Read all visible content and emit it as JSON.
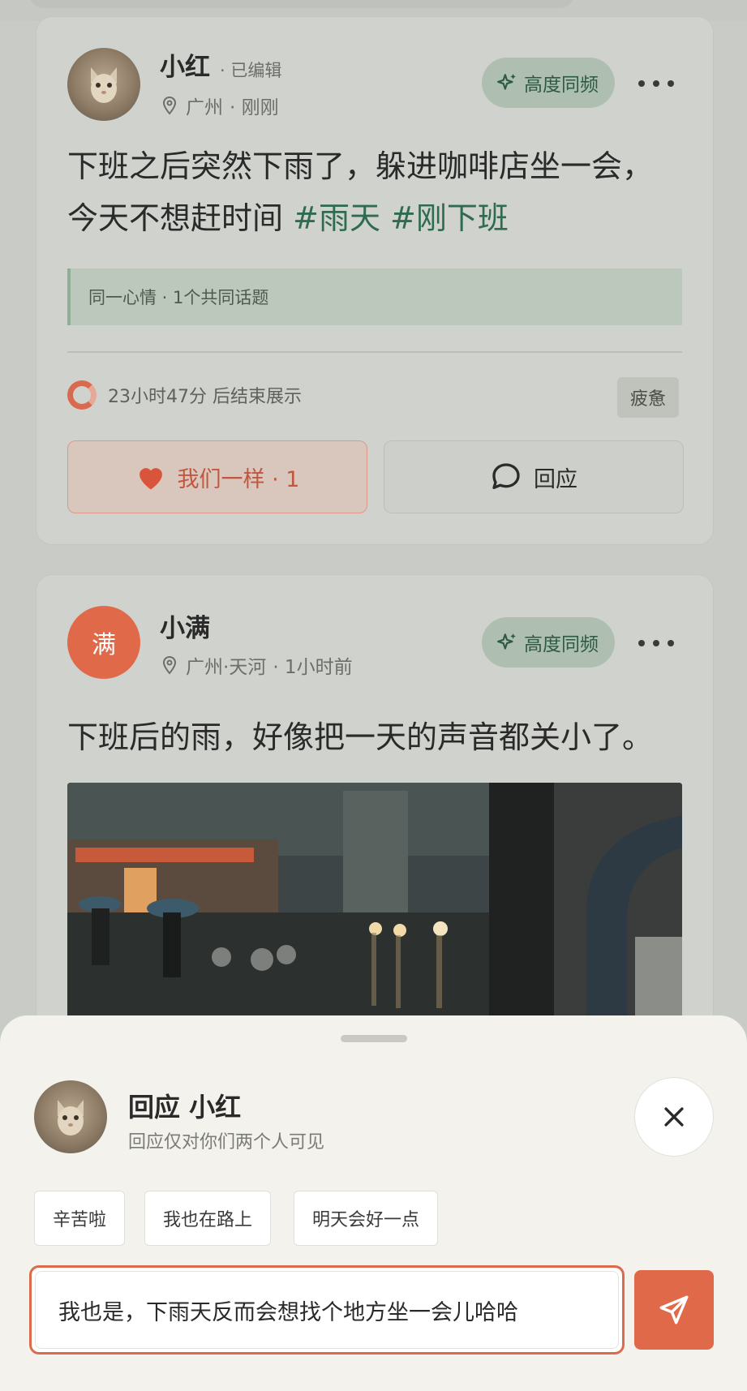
{
  "feed": {
    "posts": [
      {
        "author": "小红",
        "edited": "· 已编辑",
        "location": "广州",
        "time": "· 刚刚",
        "badge": "高度同频",
        "text": "下班之后突然下雨了，躲进咖啡店坐一会，今天不想赶时间",
        "tags": [
          "#雨天",
          "#刚下班"
        ],
        "context": "同一心情 · 1个共同话题",
        "countdown": "23小时47分 后结束展示",
        "mood": "疲惫",
        "same_label": "我们一样 · 1",
        "reply_label": "回应"
      },
      {
        "author": "小满",
        "avatar_letter": "满",
        "location": "广州·天河",
        "time": "· 1小时前",
        "badge": "高度同频",
        "text": "下班后的雨，好像把一天的声音都关小了。"
      }
    ]
  },
  "reply_sheet": {
    "title": "回应 小红",
    "subtitle": "回应仅对你们两个人可见",
    "chips": [
      "辛苦啦",
      "我也在路上",
      "明天会好一点"
    ],
    "input_value": "我也是，下雨天反而会想找个地方坐一会儿哈哈"
  },
  "colors": {
    "accent": "#e0694a",
    "sync_green": "#2e5a45",
    "tag_green": "#2f6b4f"
  }
}
